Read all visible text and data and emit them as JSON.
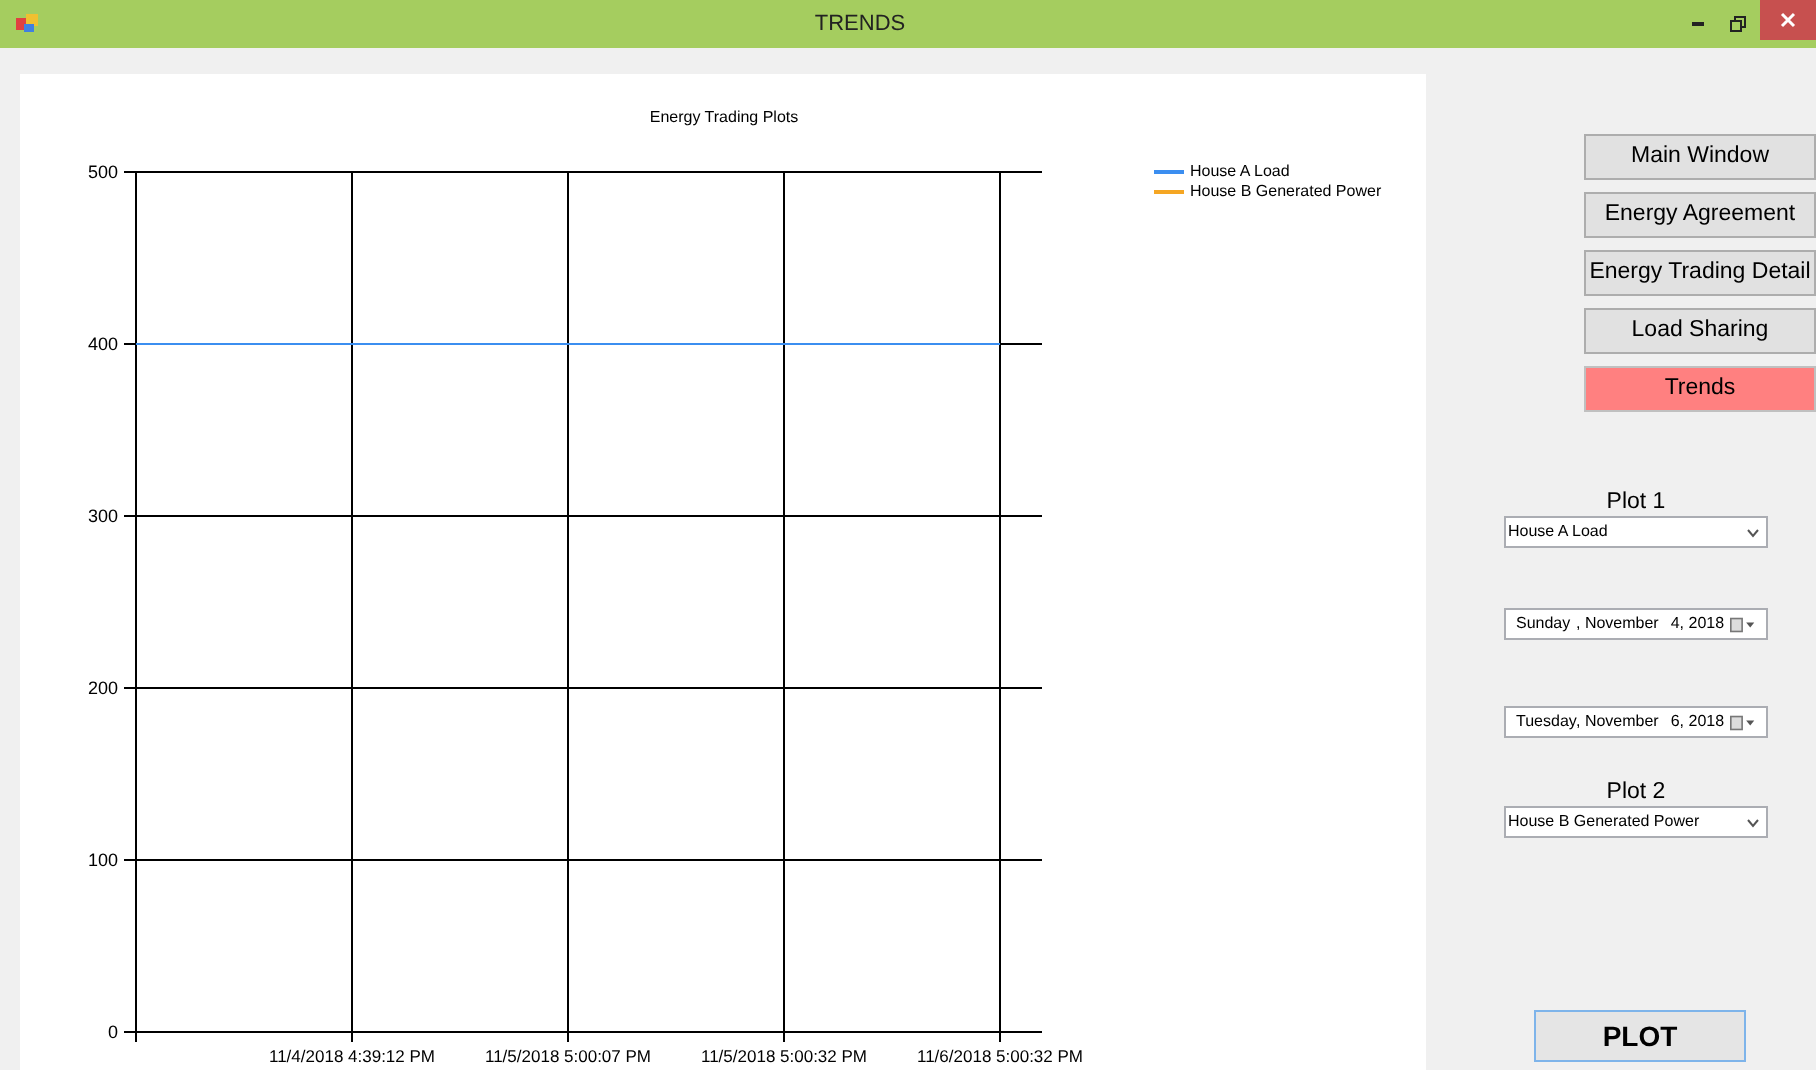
{
  "window": {
    "title": "TRENDS"
  },
  "chart": {
    "chart_data": {
      "type": "line",
      "title": "Energy Trading Plots",
      "grid": true,
      "ylim": [
        0,
        500
      ],
      "yticks": [
        0,
        100,
        200,
        300,
        400,
        500
      ],
      "categories": [
        null,
        "11/4/2018 4:39:12 PM",
        "11/5/2018 5:00:07 PM",
        "11/5/2018 5:00:32 PM",
        "11/6/2018 5:00:32 PM"
      ],
      "series": [
        {
          "name": "House A Load",
          "color": "#3b8ef0",
          "values": [
            400,
            400,
            400,
            400,
            400
          ]
        },
        {
          "name": "House B Generated Power",
          "color": "#f5a623",
          "values": [
            null,
            null,
            null,
            null,
            null
          ]
        }
      ]
    }
  },
  "nav_buttons": [
    {
      "label": "Main Window",
      "selected": false
    },
    {
      "label": "Energy Agreement",
      "selected": false
    },
    {
      "label": "Energy Trading Detail",
      "selected": false
    },
    {
      "label": "Load Sharing",
      "selected": false
    },
    {
      "label": "Trends",
      "selected": true
    }
  ],
  "plot1": {
    "label": "Plot 1",
    "value": "House A Load"
  },
  "start_date": {
    "weekday": "Sunday",
    "month": ", November",
    "day": "4, 2018"
  },
  "end_date": {
    "weekday": "Tuesday",
    "month": ", November",
    "day": "6, 2018"
  },
  "plot2": {
    "label": "Plot 2",
    "value": "House B Generated Power"
  },
  "plot_button": {
    "label": "PLOT"
  }
}
